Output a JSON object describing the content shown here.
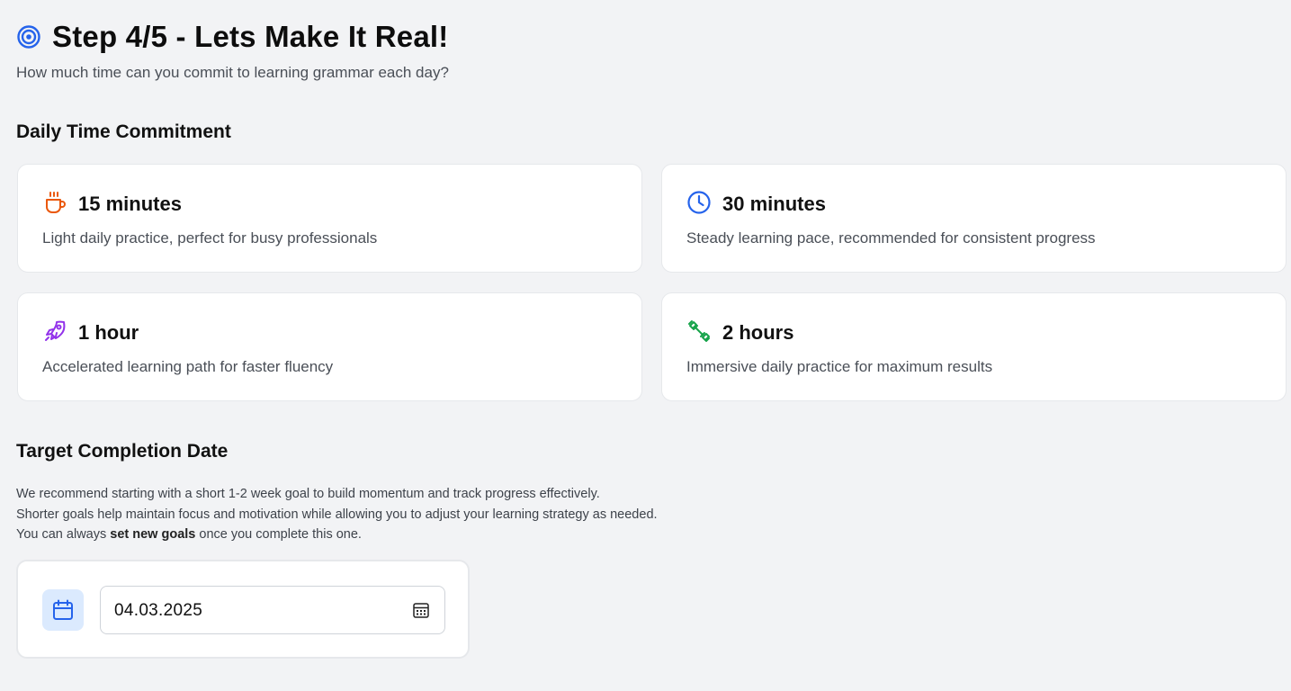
{
  "header": {
    "title": "Step 4/5 - Lets Make It Real!",
    "subtitle": "How much time can you commit to learning grammar each day?",
    "icon": "target-icon"
  },
  "daily": {
    "section_title": "Daily Time Commitment",
    "options": [
      {
        "label": "15 minutes",
        "description": "Light daily practice, perfect for busy professionals",
        "icon": "coffee-icon",
        "color": "#ea580c"
      },
      {
        "label": "30 minutes",
        "description": "Steady learning pace, recommended for consistent progress",
        "icon": "clock-icon",
        "color": "#2563eb"
      },
      {
        "label": "1 hour",
        "description": "Accelerated learning path for faster fluency",
        "icon": "rocket-icon",
        "color": "#9333ea"
      },
      {
        "label": "2 hours",
        "description": "Immersive daily practice for maximum results",
        "icon": "dumbbell-icon",
        "color": "#16a34a"
      }
    ]
  },
  "target": {
    "section_title": "Target Completion Date",
    "line1": "We recommend starting with a short 1-2 week goal to build momentum and track progress effectively.",
    "line2": "Shorter goals help maintain focus and motivation while allowing you to adjust your learning strategy as needed.",
    "line3_prefix": "You can always ",
    "line3_bold": "set new goals",
    "line3_suffix": " once you complete this one.",
    "date_value": "04.03.2025",
    "accent": "#2563eb"
  }
}
